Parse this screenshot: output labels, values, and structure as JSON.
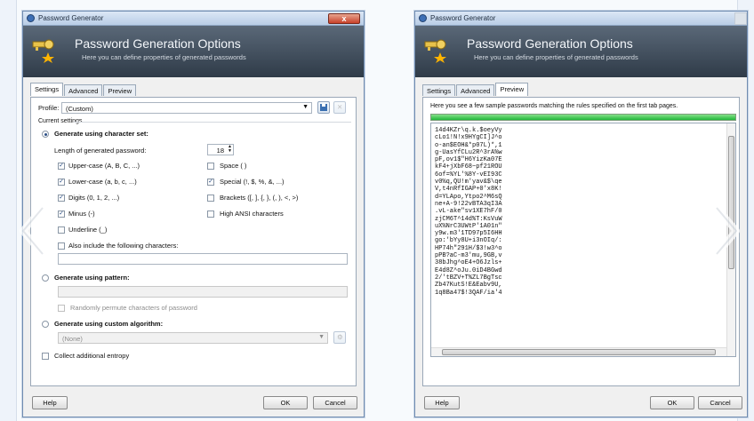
{
  "left": {
    "window_title": "Password Generator",
    "close_label": "x",
    "banner_title": "Password Generation Options",
    "banner_subtitle": "Here you can define properties of generated passwords",
    "tabs": [
      "Settings",
      "Advanced",
      "Preview"
    ],
    "active_tab": "Settings",
    "profile_label": "Profile:",
    "profile_value": "(Custom)",
    "current_settings": "Current settings",
    "gen_charset": "Generate using character set:",
    "length_label": "Length of generated password:",
    "length_value": "18",
    "options": [
      {
        "label": "Upper-case (A, B, C, ...)",
        "checked": true
      },
      {
        "label": "Space ( )",
        "checked": false
      },
      {
        "label": "Lower-case (a, b, c, ...)",
        "checked": true
      },
      {
        "label": "Special (!, $, %, &, ...)",
        "checked": true
      },
      {
        "label": "Digits (0, 1, 2, ...)",
        "checked": true
      },
      {
        "label": "Brackets ([, ], {, }, (, ), <, >)",
        "checked": false
      },
      {
        "label": "Minus (-)",
        "checked": true
      },
      {
        "label": "High ANSI characters",
        "checked": false
      },
      {
        "label": "Underline (_)",
        "checked": false
      }
    ],
    "also_include": "Also include the following characters:",
    "gen_pattern": "Generate using pattern:",
    "permute": "Randomly permute characters of password",
    "gen_custom": "Generate using custom algorithm:",
    "custom_value": "(None)",
    "collect_entropy": "Collect additional entropy",
    "help": "Help",
    "ok": "OK",
    "cancel": "Cancel"
  },
  "right": {
    "window_title": "Password Generator",
    "banner_title": "Password Generation Options",
    "banner_subtitle": "Here you can define properties of generated passwords",
    "tabs": [
      "Settings",
      "Advanced",
      "Preview"
    ],
    "active_tab": "Preview",
    "preview_desc": "Here you see a few sample passwords matching the rules specified on the first tab pages.",
    "progress": 1.0,
    "passwords": [
      "14d4KZr\\q.k.$oeyVy",
      "cLo1!N!x9HYgCI]J^o",
      "o-an$EOH&*p07L)*,1",
      "g-UasYfCLu2R^3rA%w",
      "pF,ov1$\"H6YizKa07E",
      "kF4+jXbF68~pf21ROU",
      "6of=%YL'%8Y-vEI93C",
      "v0%q,QU!m'yav&$\\qe",
      "V,t4nRfIGAP+0'x8K!",
      "d=YLApo,Ytpo2^M6sQ",
      "ne+A-9!22vBTA3qI3A",
      ".vL-ake\"sv1XE7hF/0",
      "zjCM6T^14d%T:KsVuW",
      "uX%NrC3UWtP'1A01n\"",
      "y9w.m3'1TD97p5I6HH",
      "go:'bYy8U+i3nOIq/:",
      "HP74h\"291H/$3!w3^o",
      "pPB?aC-m3'mu,9GB,v",
      "38bJhg^oE4+O6Jzls+",
      "E4d8Z^oJu.0iD4BGwd",
      "2/'tBZV+T%ZL7BgTsc",
      "Zb47KutS!E&Eabv9U,",
      "1q8Ba47$!3QAF/ia'4"
    ],
    "help": "Help",
    "ok": "OK",
    "cancel": "Cancel"
  },
  "colors": {
    "banner": "#3b4856",
    "progress": "#21b83a",
    "title_bar": "#c6d7ec"
  }
}
